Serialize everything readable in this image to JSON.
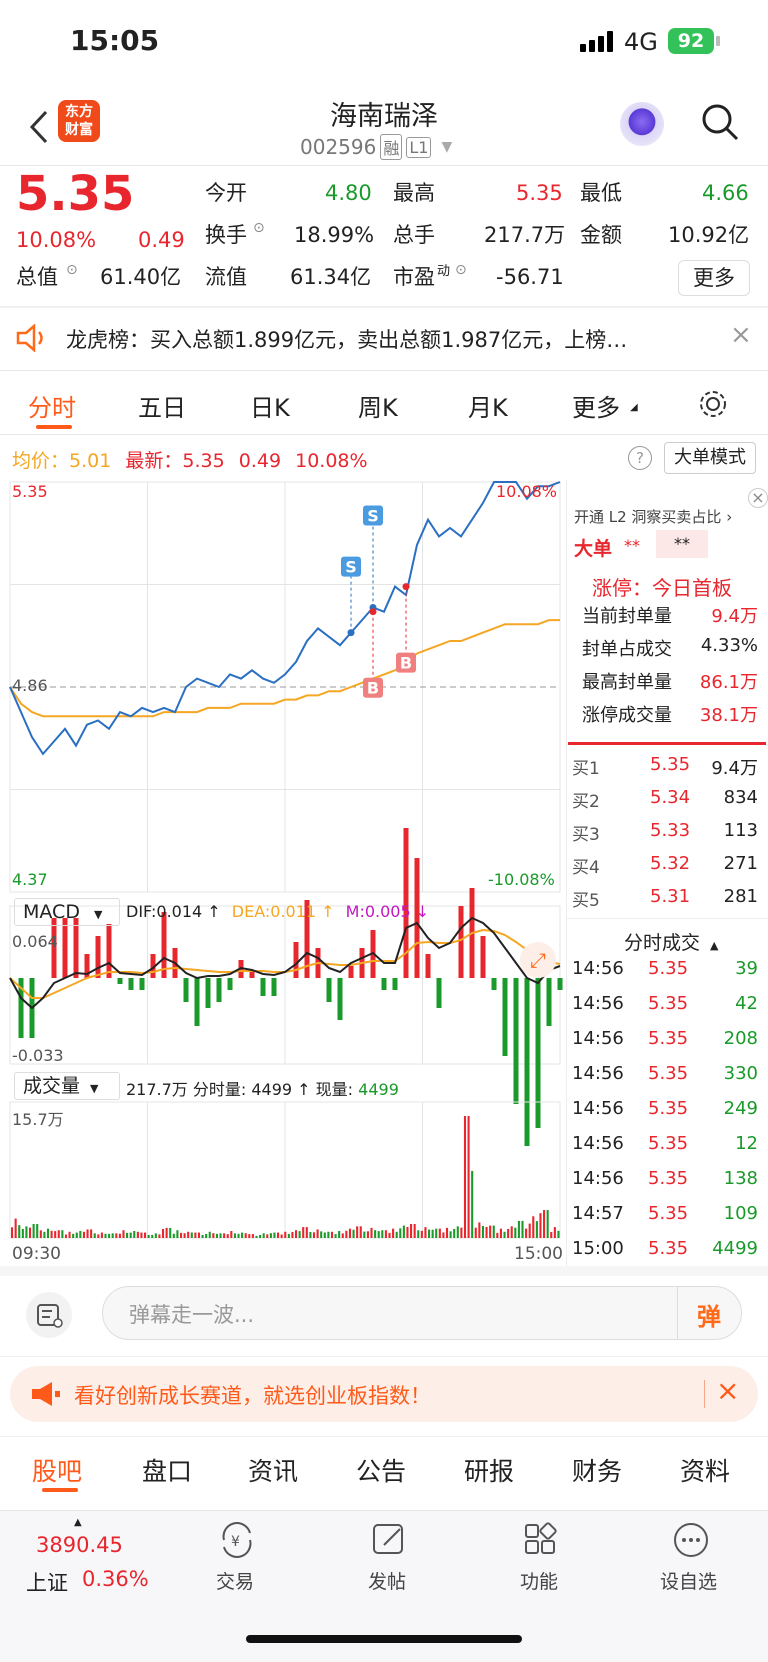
{
  "status": {
    "time": "15:05",
    "network": "4G",
    "battery": "92"
  },
  "header": {
    "logo_line1": "东方",
    "logo_line2": "财富",
    "title": "海南瑞泽",
    "code": "002596",
    "badge_rong": "融",
    "badge_l1": "L1"
  },
  "quote": {
    "price": "5.35",
    "pct": "10.08%",
    "chg": "0.49",
    "items": [
      {
        "label": "今开",
        "value": "4.80",
        "color": "green"
      },
      {
        "label": "最高",
        "value": "5.35",
        "color": "red"
      },
      {
        "label": "最低",
        "value": "4.66",
        "color": "green"
      },
      {
        "label": "换手",
        "value": "18.99%",
        "color": "black"
      },
      {
        "label": "总手",
        "value": "217.7万",
        "color": "black"
      },
      {
        "label": "金额",
        "value": "10.92亿",
        "color": "black"
      },
      {
        "label": "总值",
        "value": "61.40亿",
        "color": "black"
      },
      {
        "label": "流值",
        "value": "61.34亿",
        "color": "black"
      },
      {
        "label": "市盈",
        "value": "-56.71",
        "color": "black"
      }
    ],
    "pe_sup": "动",
    "more_btn": "更多"
  },
  "notice": {
    "text": "龙虎榜：买入总额1.899亿元，卖出总额1.987亿元，上榜…"
  },
  "tabs": [
    "分时",
    "五日",
    "日K",
    "周K",
    "月K",
    "更多"
  ],
  "chart_info": {
    "avg_label": "均价：",
    "avg": "5.01",
    "last_label": "最新：",
    "last": "5.35",
    "chg": "0.49",
    "pct": "10.08%",
    "big_order": "大单模式"
  },
  "chart_labels": {
    "top_left": "5.35",
    "top_right": "10.08%",
    "mid": "4.86",
    "bottom_left": "4.37",
    "bottom_right": "-10.08%",
    "macd": "MACD",
    "dif": "DIF:0.014 ↑",
    "dea": "DEA:0.011 ↑",
    "m": "M:0.005 ↓",
    "macd_top": "0.064",
    "macd_bottom": "-0.033",
    "vol_sel": "成交量",
    "vol_info": "217.7万 分时量: 4499 ↑ 现量:",
    "vol_now": "4499",
    "vol_top": "15.7万",
    "t_start": "09:30",
    "t_end": "15:00",
    "mark_b": "B",
    "mark_s": "S"
  },
  "chart_data": {
    "type": "line",
    "x_range": [
      "09:30",
      "15:00"
    ],
    "ylim": [
      4.37,
      5.35
    ],
    "prev_close": 4.86,
    "series": [
      {
        "values": [
          4.86,
          4.8,
          4.74,
          4.7,
          4.73,
          4.76,
          4.72,
          4.77,
          4.78,
          4.76,
          4.8,
          4.79,
          4.81,
          4.8,
          4.81,
          4.8,
          4.86,
          4.88,
          4.87,
          4.86,
          4.89,
          4.88,
          4.9,
          4.88,
          4.87,
          4.89,
          4.92,
          4.97,
          5.0,
          4.98,
          4.96,
          4.99,
          5.02,
          5.05,
          5.04,
          5.1,
          5.08,
          5.2,
          5.26,
          5.22,
          5.24,
          5.22,
          5.26,
          5.3,
          5.35,
          5.35,
          5.35,
          5.31,
          5.34,
          5.34,
          5.35
        ]
      },
      {
        "values": [
          4.86,
          4.82,
          4.8,
          4.79,
          4.79,
          4.79,
          4.79,
          4.79,
          4.79,
          4.79,
          4.79,
          4.79,
          4.79,
          4.79,
          4.8,
          4.8,
          4.8,
          4.8,
          4.81,
          4.81,
          4.81,
          4.82,
          4.82,
          4.82,
          4.82,
          4.83,
          4.83,
          4.84,
          4.84,
          4.85,
          4.85,
          4.86,
          4.87,
          4.88,
          4.89,
          4.9,
          4.92,
          4.94,
          4.95,
          4.96,
          4.97,
          4.97,
          4.98,
          4.99,
          5.0,
          5.01,
          5.01,
          5.01,
          5.01,
          5.02,
          5.02
        ]
      }
    ],
    "macd_dif": [
      0.0,
      -0.02,
      -0.03,
      -0.02,
      -0.005,
      0.0,
      0.005,
      0.004,
      0.01,
      0.015,
      0.005,
      0.004,
      0.003,
      0.01,
      0.02,
      0.015,
      0.005,
      0.0,
      0.002,
      0.002,
      0.004,
      0.01,
      0.008,
      0.004,
      0.003,
      0.006,
      0.014,
      0.025,
      0.02,
      0.01,
      0.006,
      0.015,
      0.02,
      0.025,
      0.015,
      0.015,
      0.05,
      0.055,
      0.04,
      0.03,
      0.035,
      0.05,
      0.06,
      0.055,
      0.045,
      0.03,
      0.015,
      0.0,
      -0.005,
      0.008,
      0.012
    ],
    "macd_dea": [
      0.0,
      -0.01,
      -0.02,
      -0.02,
      -0.015,
      -0.01,
      -0.005,
      0.0,
      0.003,
      0.006,
      0.006,
      0.006,
      0.005,
      0.006,
      0.009,
      0.01,
      0.009,
      0.008,
      0.007,
      0.006,
      0.006,
      0.007,
      0.007,
      0.007,
      0.006,
      0.006,
      0.008,
      0.012,
      0.015,
      0.014,
      0.013,
      0.013,
      0.015,
      0.017,
      0.017,
      0.017,
      0.025,
      0.035,
      0.036,
      0.035,
      0.035,
      0.038,
      0.045,
      0.048,
      0.047,
      0.043,
      0.036,
      0.028,
      0.02,
      0.016,
      0.014
    ],
    "volume": [
      2.5,
      1.5,
      1.8,
      1.2,
      1.0,
      0.8,
      0.9,
      1.1,
      0.7,
      0.6,
      1.0,
      0.9,
      0.7,
      0.6,
      1.3,
      1.0,
      0.8,
      0.7,
      0.8,
      0.6,
      0.9,
      0.7,
      0.5,
      0.6,
      0.7,
      0.8,
      1.0,
      1.4,
      1.1,
      0.8,
      0.9,
      1.2,
      1.5,
      1.3,
      1.0,
      1.2,
      1.6,
      1.8,
      1.4,
      1.2,
      1.3,
      1.5,
      15.7,
      2.0,
      1.6,
      1.2,
      1.5,
      2.2,
      2.8,
      3.6,
      1.4
    ]
  },
  "orderbook": {
    "l2_title": "开通 L2 洞察买卖占比 ›",
    "big_label": "大单",
    "big_v1": "**",
    "big_v2": "**",
    "limit_title": "涨停：今日首板",
    "limit_rows": [
      {
        "label": "当前封单量",
        "value": "9.4万"
      },
      {
        "label": "封单占成交",
        "value": "4.33%"
      },
      {
        "label": "最高封单量",
        "value": "86.1万"
      },
      {
        "label": "涨停成交量",
        "value": "38.1万"
      }
    ],
    "bids": [
      {
        "label": "买1",
        "price": "5.35",
        "vol": "9.4万"
      },
      {
        "label": "买2",
        "price": "5.34",
        "vol": "834"
      },
      {
        "label": "买3",
        "price": "5.33",
        "vol": "113"
      },
      {
        "label": "买4",
        "price": "5.32",
        "vol": "271"
      },
      {
        "label": "买5",
        "price": "5.31",
        "vol": "281"
      }
    ],
    "ticks_title": "分时成交",
    "ticks": [
      {
        "time": "14:56",
        "price": "5.35",
        "vol": "39"
      },
      {
        "time": "14:56",
        "price": "5.35",
        "vol": "42"
      },
      {
        "time": "14:56",
        "price": "5.35",
        "vol": "208"
      },
      {
        "time": "14:56",
        "price": "5.35",
        "vol": "330"
      },
      {
        "time": "14:56",
        "price": "5.35",
        "vol": "249"
      },
      {
        "time": "14:56",
        "price": "5.35",
        "vol": "12"
      },
      {
        "time": "14:56",
        "price": "5.35",
        "vol": "138"
      },
      {
        "time": "14:57",
        "price": "5.35",
        "vol": "109"
      },
      {
        "time": "15:00",
        "price": "5.35",
        "vol": "4499"
      }
    ]
  },
  "danmu": {
    "placeholder": "弹幕走一波...",
    "send": "弹"
  },
  "ad": {
    "text": "看好创新成长赛道，就选创业板指数！"
  },
  "bottom_tabs": [
    "股吧",
    "盘口",
    "资讯",
    "公告",
    "研报",
    "财务",
    "资料"
  ],
  "dock": {
    "index_value": "3890.45",
    "index_name": "上证",
    "index_pct": "0.36%",
    "items": [
      "交易",
      "发帖",
      "功能",
      "设自选"
    ]
  },
  "colors": {
    "red": "#e8262d",
    "green": "#1a9a2a",
    "blue": "#2a6fc2",
    "orange": "#f5a623",
    "accent": "#ff6a1a"
  }
}
